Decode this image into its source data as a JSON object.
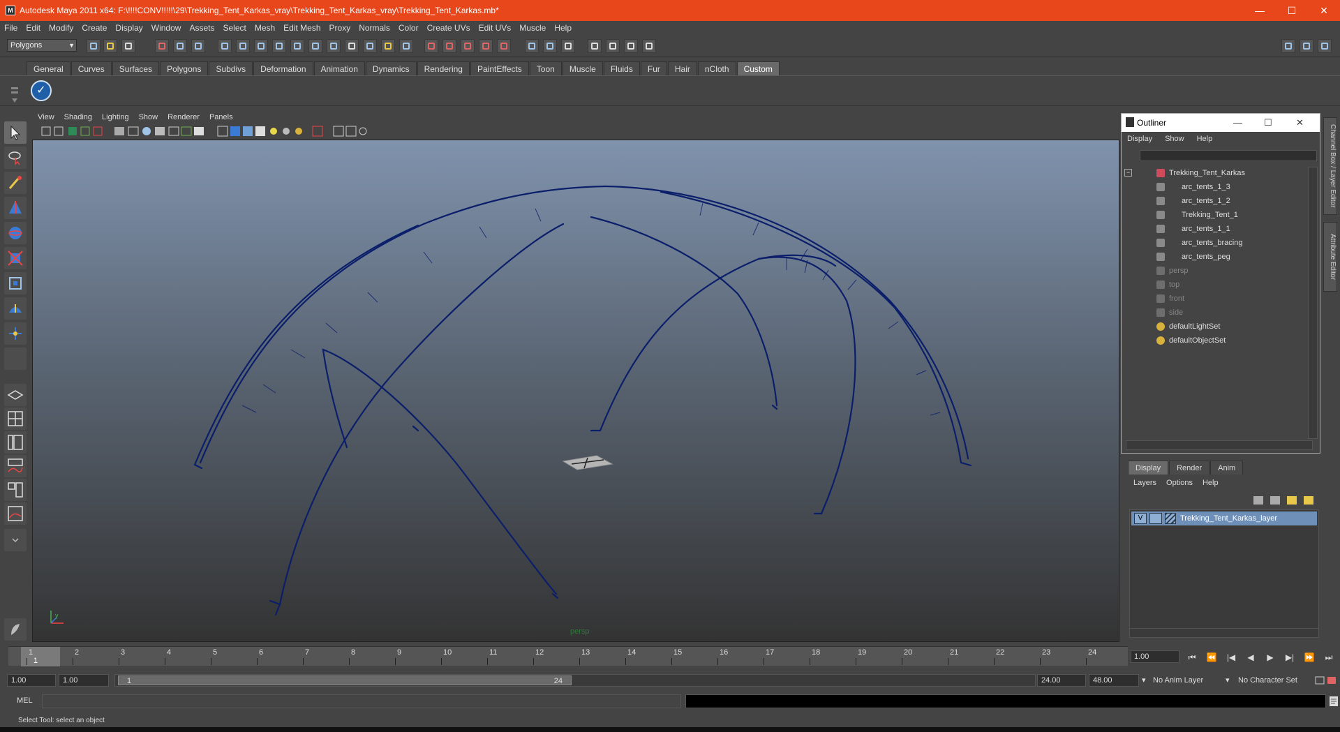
{
  "window": {
    "title": "Autodesk Maya 2011 x64: F:\\!!!!CONV!!!!!\\29\\Trekking_Tent_Karkas_vray\\Trekking_Tent_Karkas_vray\\Trekking_Tent_Karkas.mb*",
    "app_icon_letter": "M",
    "minimize": "—",
    "maximize": "☐",
    "close": "✕",
    "accent_color": "#e8461b"
  },
  "menubar": [
    "File",
    "Edit",
    "Modify",
    "Create",
    "Display",
    "Window",
    "Assets",
    "Select",
    "Mesh",
    "Edit Mesh",
    "Proxy",
    "Normals",
    "Color",
    "Create UVs",
    "Edit UVs",
    "Muscle",
    "Help"
  ],
  "statusline": {
    "mode": "Polygons"
  },
  "shelf": {
    "tabs": [
      "General",
      "Curves",
      "Surfaces",
      "Polygons",
      "Subdivs",
      "Deformation",
      "Animation",
      "Dynamics",
      "Rendering",
      "PaintEffects",
      "Toon",
      "Muscle",
      "Fluids",
      "Fur",
      "Hair",
      "nCloth",
      "Custom"
    ],
    "active_tab": "Custom",
    "button_icon": "checkmark-icon"
  },
  "viewport": {
    "menus": [
      "View",
      "Shading",
      "Lighting",
      "Show",
      "Renderer",
      "Panels"
    ],
    "camera": "persp",
    "wire_color": "#0b1e6a"
  },
  "outliner": {
    "title": "Outliner",
    "menus": [
      "Display",
      "Show",
      "Help"
    ],
    "items": [
      {
        "label": "Trekking_Tent_Karkas",
        "type": "group",
        "dim": false
      },
      {
        "label": "arc_tents_1_3",
        "type": "mesh",
        "dim": false
      },
      {
        "label": "arc_tents_1_2",
        "type": "mesh",
        "dim": false
      },
      {
        "label": "Trekking_Tent_1",
        "type": "mesh",
        "dim": false
      },
      {
        "label": "arc_tents_1_1",
        "type": "mesh",
        "dim": false
      },
      {
        "label": "arc_tents_bracing",
        "type": "mesh",
        "dim": false
      },
      {
        "label": "arc_tents_peg",
        "type": "mesh",
        "dim": false
      },
      {
        "label": "persp",
        "type": "camera",
        "dim": true
      },
      {
        "label": "top",
        "type": "camera",
        "dim": true
      },
      {
        "label": "front",
        "type": "camera",
        "dim": true
      },
      {
        "label": "side",
        "type": "camera",
        "dim": true
      },
      {
        "label": "defaultLightSet",
        "type": "set",
        "dim": false
      },
      {
        "label": "defaultObjectSet",
        "type": "set",
        "dim": false
      }
    ]
  },
  "sidetabs": [
    "Channel Box / Layer Editor",
    "Attribute Editor"
  ],
  "layer_editor": {
    "tabs": [
      "Display",
      "Render",
      "Anim"
    ],
    "active_tab": "Display",
    "menus": [
      "Layers",
      "Options",
      "Help"
    ],
    "layer": {
      "visible": "V",
      "name": "Trekking_Tent_Karkas_layer"
    }
  },
  "timeline": {
    "ticks": [
      "1",
      "2",
      "3",
      "4",
      "5",
      "6",
      "7",
      "8",
      "9",
      "10",
      "11",
      "12",
      "13",
      "14",
      "15",
      "16",
      "17",
      "18",
      "19",
      "20",
      "21",
      "22",
      "23",
      "24"
    ],
    "current": "1",
    "current_field": "1.00",
    "playback": [
      "⏮",
      "⏪",
      "|◀",
      "◀",
      "▶",
      "▶|",
      "⏩",
      "⏭"
    ]
  },
  "range": {
    "start": "1.00",
    "playback_start": "1.00",
    "thumb_start": "1",
    "thumb_end": "24",
    "playback_end": "24.00",
    "end": "48.00",
    "anim_layer": "No Anim Layer",
    "character_set": "No Character Set"
  },
  "command": {
    "label": "MEL"
  },
  "helpline": "Select Tool: select an object"
}
